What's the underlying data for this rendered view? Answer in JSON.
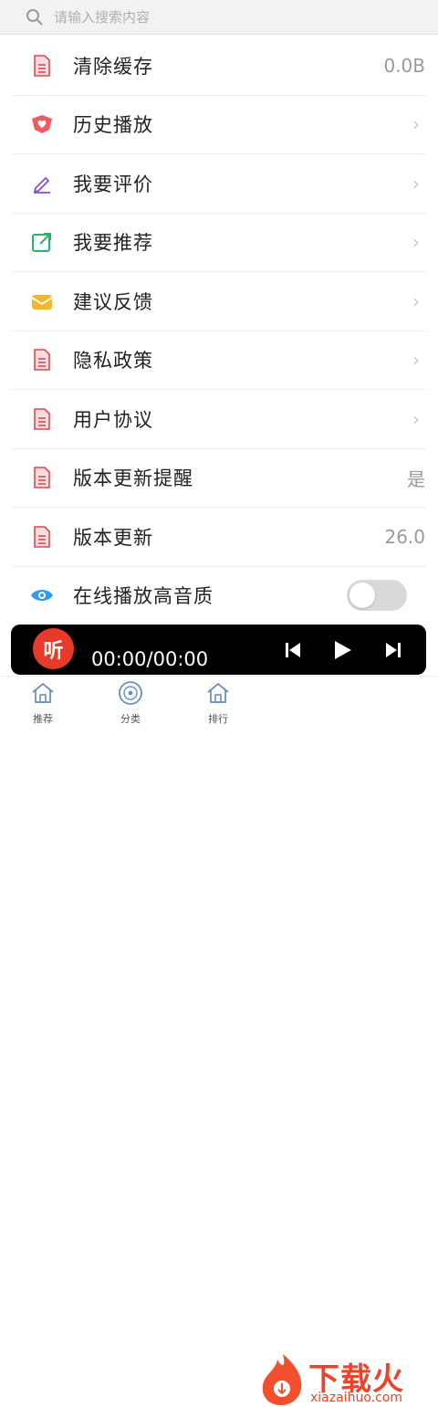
{
  "search": {
    "placeholder": "请输入搜索内容",
    "icon": "search-icon"
  },
  "menu": [
    {
      "label": "清除缓存",
      "value": "0.0B",
      "icon": "document-icon"
    },
    {
      "label": "历史播放",
      "icon": "heart-shield-icon"
    },
    {
      "label": "我要评价",
      "icon": "pencil-icon"
    },
    {
      "label": "我要推荐",
      "icon": "share-box-icon"
    },
    {
      "label": "建议反馈",
      "icon": "mail-icon"
    },
    {
      "label": "隐私政策",
      "icon": "document-icon"
    },
    {
      "label": "用户协议",
      "icon": "document-icon"
    },
    {
      "label": "版本更新提醒",
      "value": "是",
      "icon": "document-icon"
    },
    {
      "label": "版本更新",
      "value": "26.0",
      "icon": "document-icon"
    },
    {
      "label": "在线播放高音质",
      "toggle": false,
      "icon": "eye-icon"
    }
  ],
  "player": {
    "logo_text": "听",
    "time": "00:00/00:00"
  },
  "tabs": [
    {
      "label": "推荐",
      "icon": "home-icon"
    },
    {
      "label": "分类",
      "icon": "disc-icon"
    },
    {
      "label": "排行",
      "icon": "home-icon"
    }
  ],
  "watermark": {
    "text": "下载火",
    "url": "xiazaihuo.com"
  },
  "colors": {
    "accent_red": "#e83a2b",
    "toggle_off": "#d9d9d9",
    "player_bg": "#000000"
  }
}
